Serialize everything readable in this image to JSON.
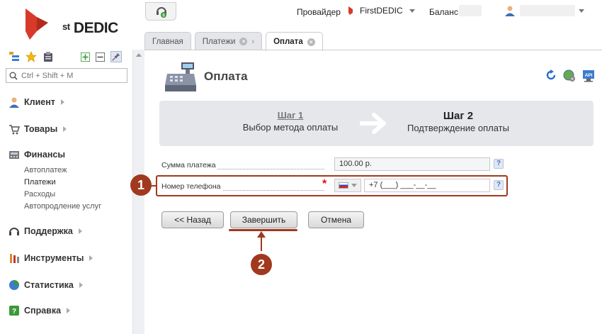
{
  "header": {
    "logo_text": "DEDIC",
    "logo_sup": "st",
    "provider_label": "Провайдер",
    "provider_value": "FirstDEDIC",
    "balance_label": "Баланс"
  },
  "tabs": [
    {
      "label": "Главная"
    },
    {
      "label": "Платежи"
    },
    {
      "label": "Оплата"
    }
  ],
  "sidebar": {
    "search_placeholder": "Ctrl + Shift + M",
    "sections": [
      {
        "label": "Клиент"
      },
      {
        "label": "Товары"
      },
      {
        "label": "Финансы"
      },
      {
        "label": "Поддержка"
      },
      {
        "label": "Инструменты"
      },
      {
        "label": "Статистика"
      },
      {
        "label": "Справка"
      }
    ],
    "finance_items": [
      "Автоплатеж",
      "Платежи",
      "Расходы",
      "Автопродление услуг"
    ]
  },
  "page": {
    "title": "Оплата",
    "api_label": "API"
  },
  "steps": {
    "step1_title": "Шаг 1",
    "step1_sub": "Выбор метода оплаты",
    "step2_title": "Шаг 2",
    "step2_sub": "Подтверждение оплаты"
  },
  "form": {
    "amount_label": "Сумма платежа",
    "amount_value": "100.00 р.",
    "phone_label": "Номер телефона",
    "phone_value": "+7 (___) ___-__-__",
    "required_mark": "*",
    "help_mark": "?"
  },
  "buttons": {
    "back": "<< Назад",
    "finish": "Завершить",
    "cancel": "Отмена"
  },
  "markers": {
    "one": "1",
    "two": "2"
  },
  "colors": {
    "accent": "#a0391e",
    "brand_red": "#d73a2a"
  }
}
